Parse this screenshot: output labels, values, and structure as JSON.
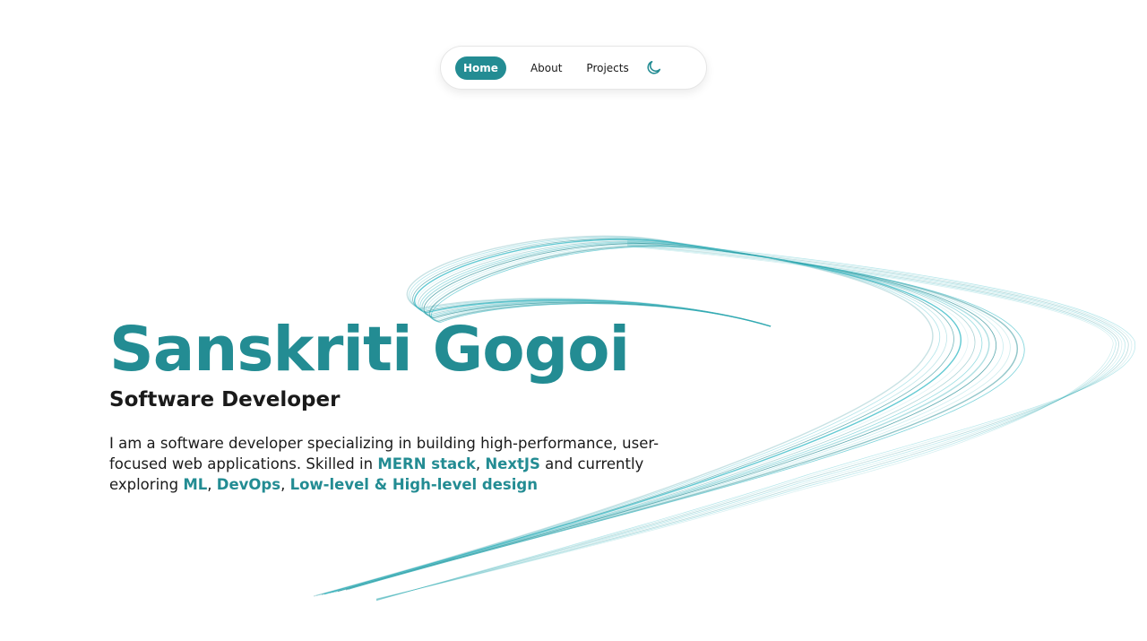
{
  "nav": {
    "items": [
      {
        "label": "Home",
        "active": true
      },
      {
        "label": "About",
        "active": false
      },
      {
        "label": "Projects",
        "active": false
      }
    ],
    "theme_toggle_icon": "moon-icon"
  },
  "hero": {
    "name": "Sanskriti Gogoi",
    "role": "Software Developer",
    "bio": {
      "intro": "I am a software developer specializing in building high-performance, user-focused web applications. Skilled in ",
      "skill_1": "MERN stack",
      "sep_1": ", ",
      "skill_2": "NextJS",
      "mid": " and currently exploring ",
      "explore_1": "ML",
      "sep_2": ", ",
      "explore_2": "DevOps",
      "sep_3": ", ",
      "explore_3": "Low-level & High-level design"
    }
  },
  "theme": {
    "accent": "#238c93",
    "text": "#1a1a1a",
    "background": "#ffffff"
  }
}
